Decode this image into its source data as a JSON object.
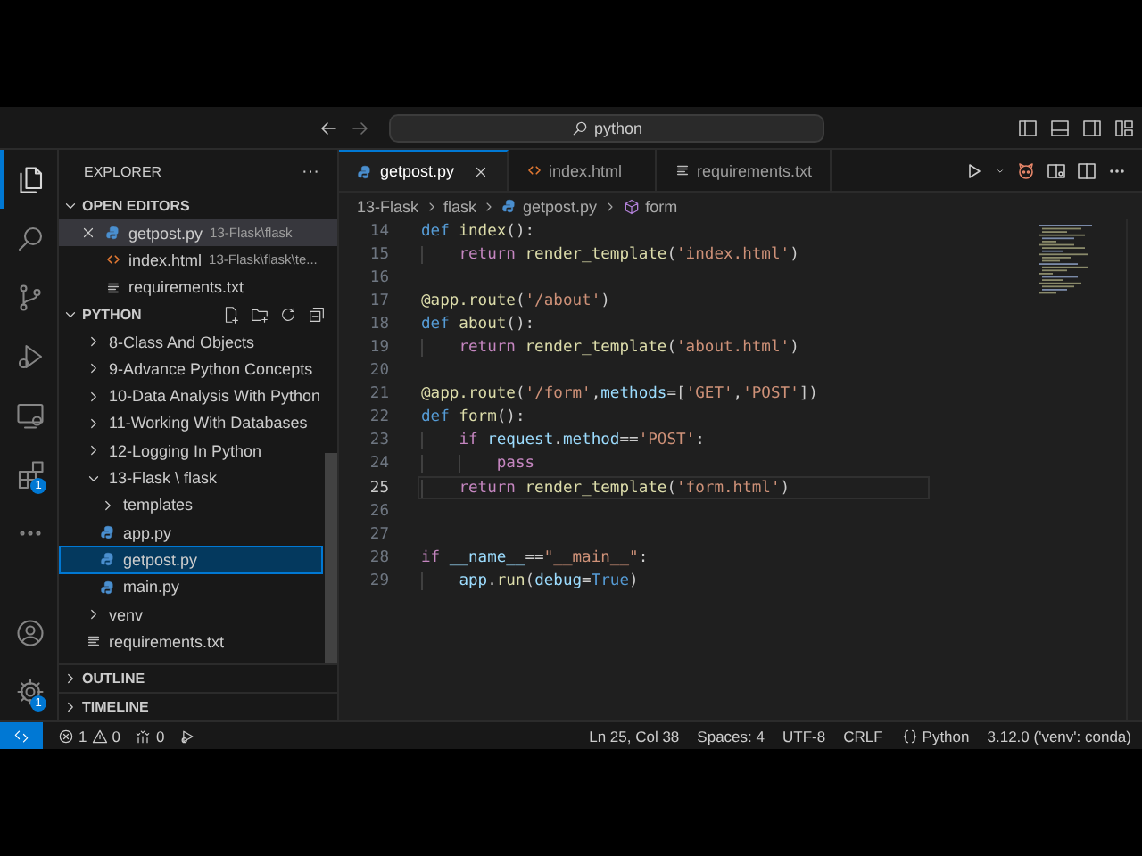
{
  "title_bar": {
    "search": "python"
  },
  "activity_bar": {
    "items": [
      {
        "kind": "files",
        "selected": true
      },
      {
        "kind": "search",
        "selected": false
      },
      {
        "kind": "branch",
        "selected": false
      },
      {
        "kind": "debug",
        "selected": false
      },
      {
        "kind": "remote",
        "selected": false
      },
      {
        "kind": "extensions",
        "selected": false,
        "badge": "1"
      },
      {
        "kind": "more",
        "selected": false
      }
    ],
    "bottom": [
      {
        "kind": "account"
      },
      {
        "kind": "gear",
        "badge": "1"
      }
    ]
  },
  "sidebar": {
    "title": "EXPLORER",
    "more": "···",
    "open_editors": {
      "title": "OPEN EDITORS",
      "expanded": true,
      "items": [
        {
          "name": "getpost.py",
          "description": "13-Flask\\flask",
          "kind": "python",
          "selected": true
        },
        {
          "name": "index.html",
          "description": "13-Flask\\flask\\te...",
          "kind": "html",
          "selected": false
        },
        {
          "name": "requirements.txt",
          "kind": "text",
          "selected": false
        }
      ]
    },
    "folder": {
      "title": "PYTHON",
      "expanded": true,
      "items": [
        {
          "label": "8-Class And Objects",
          "kind": "folder",
          "expanded": false,
          "selected": false
        },
        {
          "label": "9-Advance Python Concepts",
          "kind": "folder",
          "expanded": false,
          "selected": false
        },
        {
          "label": "10-Data Analysis With Python",
          "kind": "folder",
          "expanded": false,
          "selected": false
        },
        {
          "label": "11-Working With Databases",
          "kind": "folder",
          "expanded": false,
          "selected": false
        },
        {
          "label": "12-Logging In Python",
          "kind": "folder",
          "expanded": false,
          "selected": false
        },
        {
          "label": "13-Flask \\ flask",
          "kind": "folder",
          "expanded": true,
          "selected": false,
          "children": [
            {
              "label": "templates",
              "kind": "folder",
              "expanded": false,
              "selected": false
            },
            {
              "label": "app.py",
              "kind": "python",
              "selected": false
            },
            {
              "label": "getpost.py",
              "kind": "python",
              "selected": true
            },
            {
              "label": "main.py",
              "kind": "python",
              "selected": false
            }
          ]
        },
        {
          "label": "venv",
          "kind": "folder",
          "expanded": false,
          "selected": false
        },
        {
          "label": "requirements.txt",
          "kind": "text",
          "selected": false
        }
      ]
    },
    "sections": [
      {
        "title": "OUTLINE",
        "expanded": false
      },
      {
        "title": "TIMELINE",
        "expanded": false
      }
    ]
  },
  "editor": {
    "tabs": [
      {
        "label": "getpost.py",
        "kind": "python",
        "selected": true
      },
      {
        "label": "index.html",
        "kind": "html",
        "selected": false
      },
      {
        "label": "requirements.txt",
        "kind": "text",
        "selected": false
      }
    ],
    "breadcrumbs": [
      {
        "label": "13-Flask",
        "kind": "plain"
      },
      {
        "label": "flask",
        "kind": "plain"
      },
      {
        "label": "getpost.py",
        "kind": "python"
      },
      {
        "label": "form",
        "kind": "symbol"
      }
    ],
    "lines": [
      {
        "number": "14",
        "current": false,
        "tokens": [
          {
            "keyword": "def"
          },
          {
            "function": " index"
          },
          {
            "plain": "():"
          }
        ]
      },
      {
        "number": "15",
        "current": false,
        "tokens": [
          {
            "control": "    return"
          },
          {
            "function": " render_template"
          },
          {
            "plain": "("
          },
          {
            "string": "'index.html'"
          },
          {
            "plain": ")"
          }
        ]
      },
      {
        "number": "16",
        "current": false
      },
      {
        "number": "17",
        "current": false,
        "tokens": [
          {
            "function": "@app.route"
          },
          {
            "plain": "("
          },
          {
            "string": "'/about'"
          },
          {
            "plain": ")"
          }
        ]
      },
      {
        "number": "18",
        "current": false,
        "tokens": [
          {
            "keyword": "def"
          },
          {
            "function": " about"
          },
          {
            "plain": "():"
          }
        ]
      },
      {
        "number": "19",
        "current": false,
        "tokens": [
          {
            "control": "    return"
          },
          {
            "function": " render_template"
          },
          {
            "plain": "("
          },
          {
            "string": "'about.html'"
          },
          {
            "plain": ")"
          }
        ]
      },
      {
        "number": "20",
        "current": false
      },
      {
        "number": "21",
        "current": false,
        "tokens": [
          {
            "function": "@app.route"
          },
          {
            "plain": "("
          },
          {
            "string": "'/form'"
          },
          {
            "plain": ","
          },
          {
            "variable": "methods"
          },
          {
            "plain": "=["
          },
          {
            "string": "'GET'"
          },
          {
            "plain": ","
          },
          {
            "string": "'POST'"
          },
          {
            "plain": "])"
          }
        ]
      },
      {
        "number": "22",
        "current": false,
        "tokens": [
          {
            "keyword": "def"
          },
          {
            "function": " form"
          },
          {
            "plain": "():"
          }
        ]
      },
      {
        "number": "23",
        "current": false,
        "tokens": [
          {
            "control": "    if"
          },
          {
            "variable": " request"
          },
          {
            "plain": "."
          },
          {
            "variable": "method"
          },
          {
            "plain": "=="
          },
          {
            "string": "'POST'"
          },
          {
            "plain": ":"
          }
        ]
      },
      {
        "number": "24",
        "current": false,
        "tokens": [
          {
            "control": "        pass"
          }
        ]
      },
      {
        "number": "25",
        "current": true,
        "tokens": [
          {
            "control": "    return"
          },
          {
            "function": " render_template"
          },
          {
            "plain": "("
          },
          {
            "string": "'form.html'"
          },
          {
            "plain": ")"
          }
        ]
      },
      {
        "number": "26",
        "current": false
      },
      {
        "number": "27",
        "current": false
      },
      {
        "number": "28",
        "current": false,
        "tokens": [
          {
            "control": "if"
          },
          {
            "variable": " __name__"
          },
          {
            "plain": "=="
          },
          {
            "string": "\"__main__\""
          },
          {
            "plain": ":"
          }
        ]
      },
      {
        "number": "29",
        "current": false,
        "tokens": [
          {
            "variable": "    app"
          },
          {
            "plain": "."
          },
          {
            "function": "run"
          },
          {
            "plain": "("
          },
          {
            "variable": "debug"
          },
          {
            "plain": "="
          },
          {
            "keyword": "True"
          },
          {
            "plain": ")"
          }
        ]
      }
    ]
  },
  "status_bar": {
    "left": [
      {
        "kind": "errors",
        "text": "1"
      },
      {
        "kind": "warnings",
        "text": "0"
      },
      {
        "kind": "ports",
        "text": "0"
      },
      {
        "kind": "live"
      }
    ],
    "right": [
      {
        "kind": "text",
        "text": "Ln 25, Col 38"
      },
      {
        "kind": "text",
        "text": "Spaces: 4"
      },
      {
        "kind": "text",
        "text": "UTF-8"
      },
      {
        "kind": "text",
        "text": "CRLF"
      },
      {
        "kind": "language",
        "text": "Python"
      },
      {
        "kind": "text",
        "text": "3.12.0 ('venv': conda)"
      }
    ]
  }
}
